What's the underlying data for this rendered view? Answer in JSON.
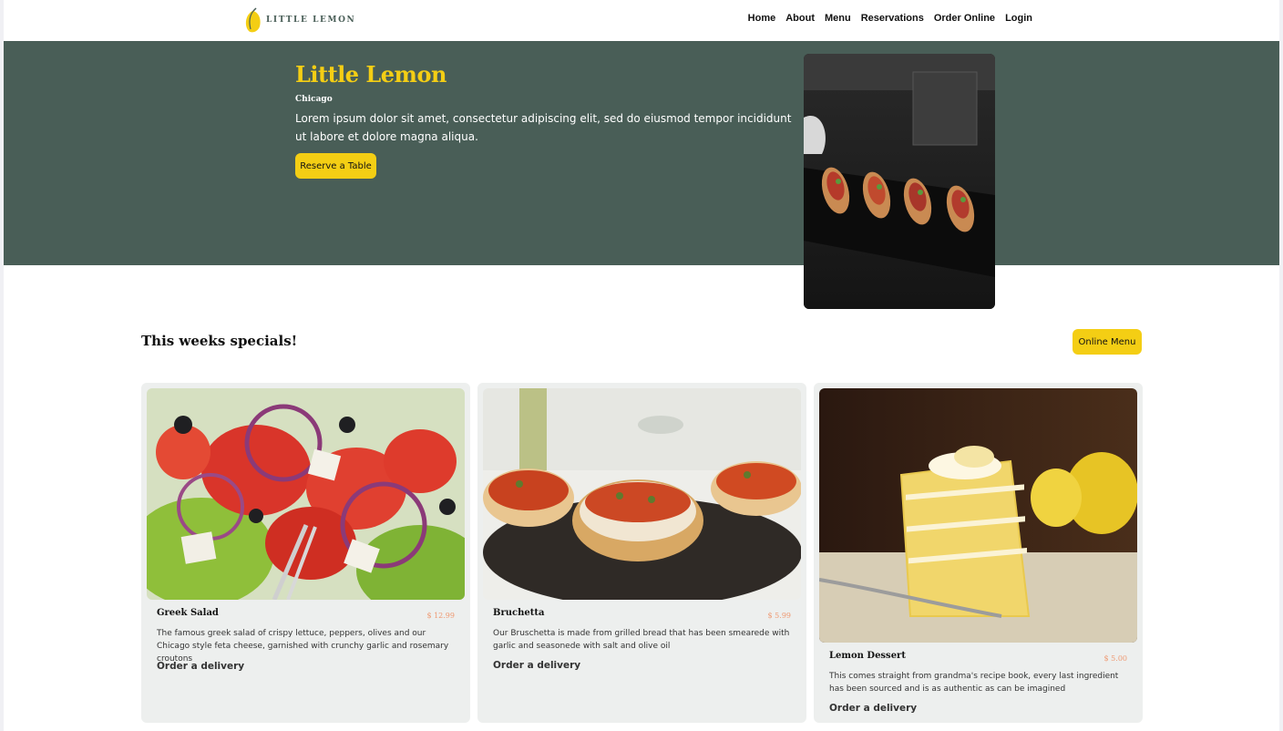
{
  "nav": {
    "logo_text": "LITTLE LEMON",
    "links": [
      "Home",
      "About",
      "Menu",
      "Reservations",
      "Order Online",
      "Login"
    ]
  },
  "hero": {
    "title": "Little Lemon",
    "subtitle": "Chicago",
    "description": "Lorem ipsum dolor sit amet, consectetur adipiscing elit, sed do eiusmod tempor incididunt ut labore et dolore magna aliqua.",
    "button_label": "Reserve a Table"
  },
  "specials": {
    "title": "This weeks specials!",
    "button_label": "Online Menu",
    "cards": [
      {
        "name": "Greek Salad",
        "price": "$ 12.99",
        "description": "The famous greek salad of crispy lettuce, peppers, olives and our Chicago style feta cheese, garnished with crunchy garlic and rosemary croutons",
        "link": "Order a delivery"
      },
      {
        "name": "Bruchetta",
        "price": "$ 5.99",
        "description": "Our Bruschetta is made from grilled bread that has been smearede with garlic and seasonede with salt and olive oil",
        "link": "Order a delivery"
      },
      {
        "name": "Lemon Dessert",
        "price": "$ 5.00",
        "description": "This comes straight from grandma's recipe book, every last ingredient has been sourced and is as authentic as can be imagined",
        "link": "Order a delivery"
      }
    ]
  },
  "colors": {
    "primary_green": "#495e57",
    "primary_yellow": "#f4ce14",
    "card_bg": "#edefee",
    "price_accent": "#ee9972"
  }
}
